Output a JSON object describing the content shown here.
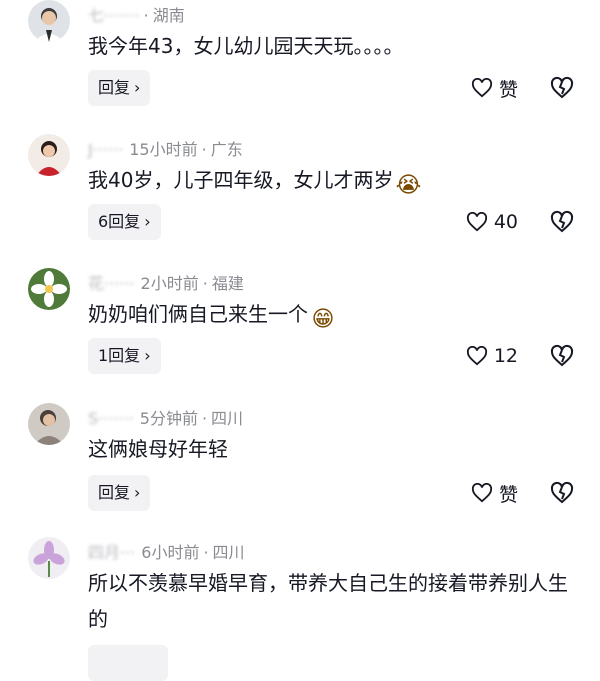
{
  "comments": [
    {
      "name": "七·······",
      "time": "",
      "location": "湖南",
      "text": "我今年43，女儿幼儿园天天玩。。。。",
      "emoji": "",
      "reply_label": "回复",
      "like_label": "赞",
      "icons": {
        "avatar": "avatar-man",
        "like": "heart-outline-icon",
        "dislike": "broken-heart-icon"
      }
    },
    {
      "name": "J······",
      "time": "15小时前",
      "location": "广东",
      "text": "我40岁，儿子四年级，女儿才两岁",
      "emoji": "😭",
      "reply_label": "6回复",
      "like_label": "40",
      "icons": {
        "avatar": "avatar-woman-red",
        "like": "heart-outline-icon",
        "dislike": "broken-heart-icon"
      }
    },
    {
      "name": "花······",
      "time": "2小时前",
      "location": "福建",
      "text": "奶奶咱们俩自己来生一个",
      "emoji": "😁",
      "reply_label": "1回复",
      "like_label": "12",
      "icons": {
        "avatar": "avatar-flower",
        "like": "heart-outline-icon",
        "dislike": "broken-heart-icon"
      }
    },
    {
      "name": "S·······",
      "time": "5分钟前",
      "location": "四川",
      "text": "这俩娘母好年轻",
      "emoji": "",
      "reply_label": "回复",
      "like_label": "赞",
      "icons": {
        "avatar": "avatar-woman-gray",
        "like": "heart-outline-icon",
        "dislike": "broken-heart-icon"
      }
    },
    {
      "name": "四月···",
      "time": "6小时前",
      "location": "四川",
      "text": "所以不羡慕早婚早育，带养大自己生的接着带养别人生的",
      "emoji": "",
      "reply_label": "",
      "like_label": "",
      "icons": {
        "avatar": "avatar-lily",
        "like": "heart-outline-icon",
        "dislike": "broken-heart-icon"
      }
    }
  ],
  "colors": {
    "text": "#161823",
    "meta": "#8a8b91",
    "reply_bg": "#f2f2f4"
  }
}
